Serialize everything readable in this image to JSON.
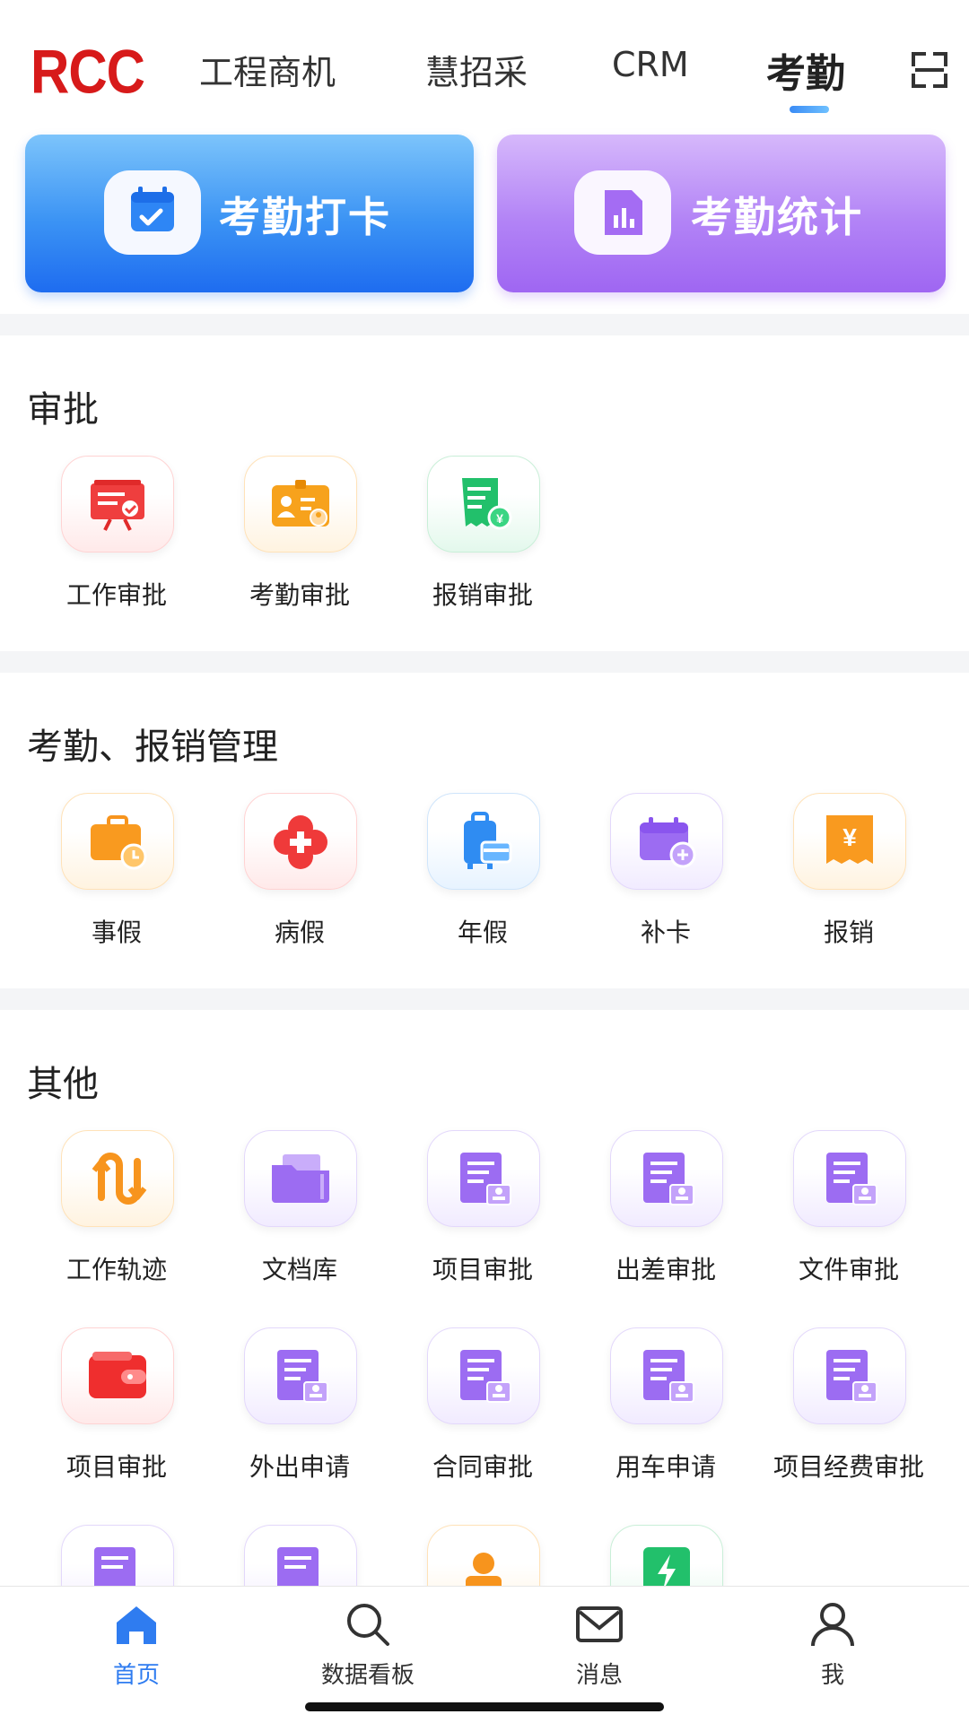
{
  "header": {
    "logo": "RCC",
    "tabs": [
      {
        "label": "工程商机"
      },
      {
        "label": "慧招采"
      },
      {
        "label": "CRM"
      },
      {
        "label": "考勤"
      }
    ],
    "active_tab": "考勤"
  },
  "cards": [
    {
      "label": "考勤打卡",
      "icon": "calendar-check-icon"
    },
    {
      "label": "考勤统计",
      "icon": "bar-chart-icon"
    }
  ],
  "sections": {
    "approval": {
      "title": "审批",
      "items": [
        {
          "label": "工作审批",
          "icon": "presentation-board-icon"
        },
        {
          "label": "考勤审批",
          "icon": "id-card-icon"
        },
        {
          "label": "报销审批",
          "icon": "receipt-yen-icon"
        }
      ]
    },
    "attendance": {
      "title": "考勤、报销管理",
      "items": [
        {
          "label": "事假",
          "icon": "briefcase-clock-icon"
        },
        {
          "label": "病假",
          "icon": "medical-cross-icon"
        },
        {
          "label": "年假",
          "icon": "luggage-card-icon"
        },
        {
          "label": "补卡",
          "icon": "calendar-plus-icon"
        },
        {
          "label": "报销",
          "icon": "yen-receipt-icon"
        }
      ]
    },
    "other": {
      "title": "其他",
      "items": [
        {
          "label": "工作轨迹",
          "icon": "route-icon"
        },
        {
          "label": "文档库",
          "icon": "folder-icon"
        },
        {
          "label": "项目审批",
          "icon": "document-user-icon"
        },
        {
          "label": "出差审批",
          "icon": "document-user-icon"
        },
        {
          "label": "文件审批",
          "icon": "document-user-icon"
        },
        {
          "label": "项目审批",
          "icon": "wallet-icon"
        },
        {
          "label": "外出申请",
          "icon": "document-user-icon"
        },
        {
          "label": "合同审批",
          "icon": "document-user-icon"
        },
        {
          "label": "用车申请",
          "icon": "document-user-icon"
        },
        {
          "label": "项目经费审批",
          "icon": "document-user-icon"
        }
      ]
    }
  },
  "bottom_nav": [
    {
      "label": "首页",
      "icon": "home-icon",
      "active": true
    },
    {
      "label": "数据看板",
      "icon": "search-icon"
    },
    {
      "label": "消息",
      "icon": "mail-icon"
    },
    {
      "label": "我",
      "icon": "user-icon"
    }
  ],
  "colors": {
    "accent_blue": "#2f7cf0",
    "brand_red": "#d71a1a",
    "purple": "#9f66f2"
  }
}
